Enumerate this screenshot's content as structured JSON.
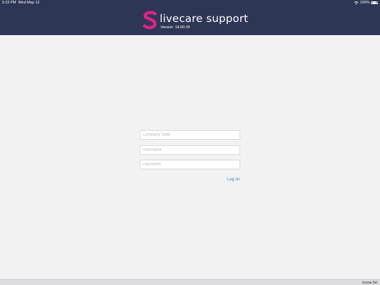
{
  "status_bar": {
    "time": "5:23 PM",
    "date": "Wed May 12",
    "battery": "100%",
    "wifi_icon": "wifi-icon",
    "battery_icon": "battery-icon"
  },
  "header": {
    "logo_icon": "s-logo-icon",
    "logo_color": "#e0218a",
    "title": "livecare support",
    "version": "Version: 18.00.00",
    "background": "#2e3656"
  },
  "login": {
    "company_code_placeholder": "Company code",
    "username_placeholder": "Username",
    "password_placeholder": "Password",
    "company_code_value": "",
    "username_value": "",
    "password_value": "",
    "log_on_label": "Log on",
    "accent": "#2a86c9"
  },
  "footer": {
    "text": "Icona Srl"
  }
}
